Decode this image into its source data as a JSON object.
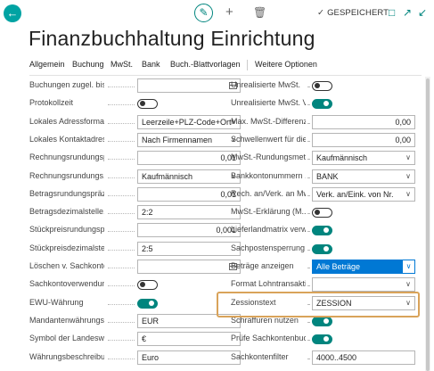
{
  "header": {
    "saved_label": "GESPEICHERT"
  },
  "page": {
    "title": "Finanzbuchhaltung Einrichtung"
  },
  "actions": [
    "Allgemein",
    "Buchung",
    "MwSt.",
    "Bank",
    "Buch.-Blattvorlagen",
    "Weitere Optionen"
  ],
  "left": [
    {
      "label": "Buchungen zugel. bis",
      "type": "date",
      "value": ""
    },
    {
      "label": "Protokollzeit",
      "type": "toggle",
      "on": false
    },
    {
      "label": "Lokales Adressformat",
      "type": "select",
      "value": "Leerzeile+PLZ-Code+Ort"
    },
    {
      "label": "Lokales Kontaktadres...",
      "type": "select",
      "value": "Nach Firmennamen"
    },
    {
      "label": "Rechnungsrundungsp...",
      "type": "number",
      "value": "0,01"
    },
    {
      "label": "Rechnungsrundungs...",
      "type": "select",
      "value": "Kaufmännisch"
    },
    {
      "label": "Betragsrundungspräz...",
      "type": "number",
      "value": "0,01"
    },
    {
      "label": "Betragsdezimalstelle...",
      "type": "text",
      "value": "2:2"
    },
    {
      "label": "Stückpreisrundungsp...",
      "type": "number",
      "value": "0,001"
    },
    {
      "label": "Stückpreisdezimalstel...",
      "type": "text",
      "value": "2:5"
    },
    {
      "label": "Löschen v. Sachkonte...",
      "type": "date",
      "value": ""
    },
    {
      "label": "Sachkontoverwendun...",
      "type": "toggle",
      "on": false
    },
    {
      "label": "EWU-Währung",
      "type": "toggle",
      "on": true
    },
    {
      "label": "Mandantenwährungs...",
      "type": "text",
      "value": "EUR"
    },
    {
      "label": "Symbol der Landesw...",
      "type": "text",
      "value": "€"
    },
    {
      "label": "Währungsbeschreibu...",
      "type": "text",
      "value": "Euro"
    }
  ],
  "right": [
    {
      "label": "Unrealisierte MwSt.",
      "type": "toggle",
      "on": false
    },
    {
      "label": "Unrealisierte MwSt. V...",
      "type": "toggle",
      "on": true
    },
    {
      "label": "Max. MwSt.-Differenz...",
      "type": "number",
      "value": "0,00"
    },
    {
      "label": "Schwellenwert für die...",
      "type": "number",
      "value": "0,00"
    },
    {
      "label": "MwSt.-Rundungsmet...",
      "type": "select",
      "value": "Kaufmännisch"
    },
    {
      "label": "Bankkontonummern ...",
      "type": "select",
      "value": "BANK"
    },
    {
      "label": "Rech. an/Verk. an MwSt...",
      "type": "select",
      "value": "Verk. an/Eink. von Nr."
    },
    {
      "label": "MwSt.-Erklärung (M...",
      "type": "toggle",
      "on": false
    },
    {
      "label": "Lieferlandmatrix verw...",
      "type": "toggle",
      "on": true
    },
    {
      "label": "Sachpostensperrung ...",
      "type": "toggle",
      "on": true
    },
    {
      "label": "Beträge anzeigen",
      "type": "select",
      "value": "Alle Beträge",
      "selected": true
    },
    {
      "label": "Format Lohntransakti...",
      "type": "select",
      "value": ""
    },
    {
      "label": "Zessionstext",
      "type": "select",
      "value": "ZESSION"
    },
    {
      "label": "Schraffuren nutzen",
      "type": "toggle",
      "on": true
    },
    {
      "label": "Prüfe Sachkontenbuc...",
      "type": "toggle",
      "on": true
    },
    {
      "label": "Sachkontenfilter",
      "type": "text",
      "value": "4000..4500"
    }
  ]
}
